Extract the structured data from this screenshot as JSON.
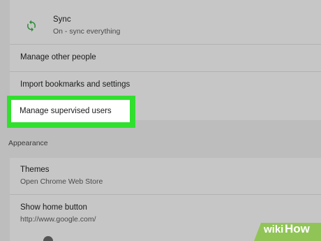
{
  "people": {
    "sync": {
      "title": "Sync",
      "subtitle": "On - sync everything",
      "icon": "sync-icon"
    },
    "manage_other_people": "Manage other people",
    "import_bookmarks": "Import bookmarks and settings",
    "manage_supervised_users": "Manage supervised users"
  },
  "appearance": {
    "header": "Appearance",
    "themes": {
      "title": "Themes",
      "subtitle": "Open Chrome Web Store"
    },
    "home_button": {
      "title": "Show home button",
      "subtitle": "http://www.google.com/"
    }
  },
  "watermark": {
    "prefix": "wiki",
    "suffix": "How"
  },
  "colors": {
    "highlight": "#31e02e",
    "sync_icon": "#2e8b3a",
    "watermark_bg": "#8bc34a"
  }
}
